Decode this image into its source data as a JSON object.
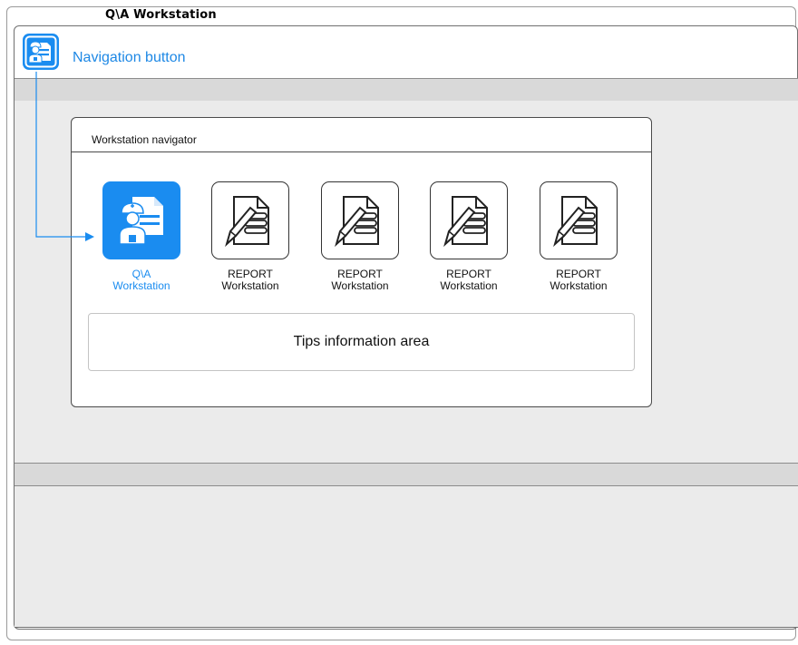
{
  "window": {
    "title": "Q\\A  Workstation"
  },
  "navigation_button": {
    "label": "Navigation button",
    "icon": "doctor-workstation-icon"
  },
  "navigator": {
    "title": "Workstation navigator",
    "items": [
      {
        "line1": "Q\\A",
        "line2": "Workstation",
        "icon": "doctor-workstation-icon",
        "active": true
      },
      {
        "line1": "REPORT",
        "line2": "Workstation",
        "icon": "report-document-icon",
        "active": false
      },
      {
        "line1": "REPORT",
        "line2": "Workstation",
        "icon": "report-document-icon",
        "active": false
      },
      {
        "line1": "REPORT",
        "line2": "Workstation",
        "icon": "report-document-icon",
        "active": false
      },
      {
        "line1": "REPORT",
        "line2": "Workstation",
        "icon": "report-document-icon",
        "active": false
      }
    ],
    "tips": "Tips information area"
  },
  "colors": {
    "accent": "#1a8cf0",
    "panel_bg": "#ebebeb",
    "band_bg": "#d9d9d9"
  }
}
